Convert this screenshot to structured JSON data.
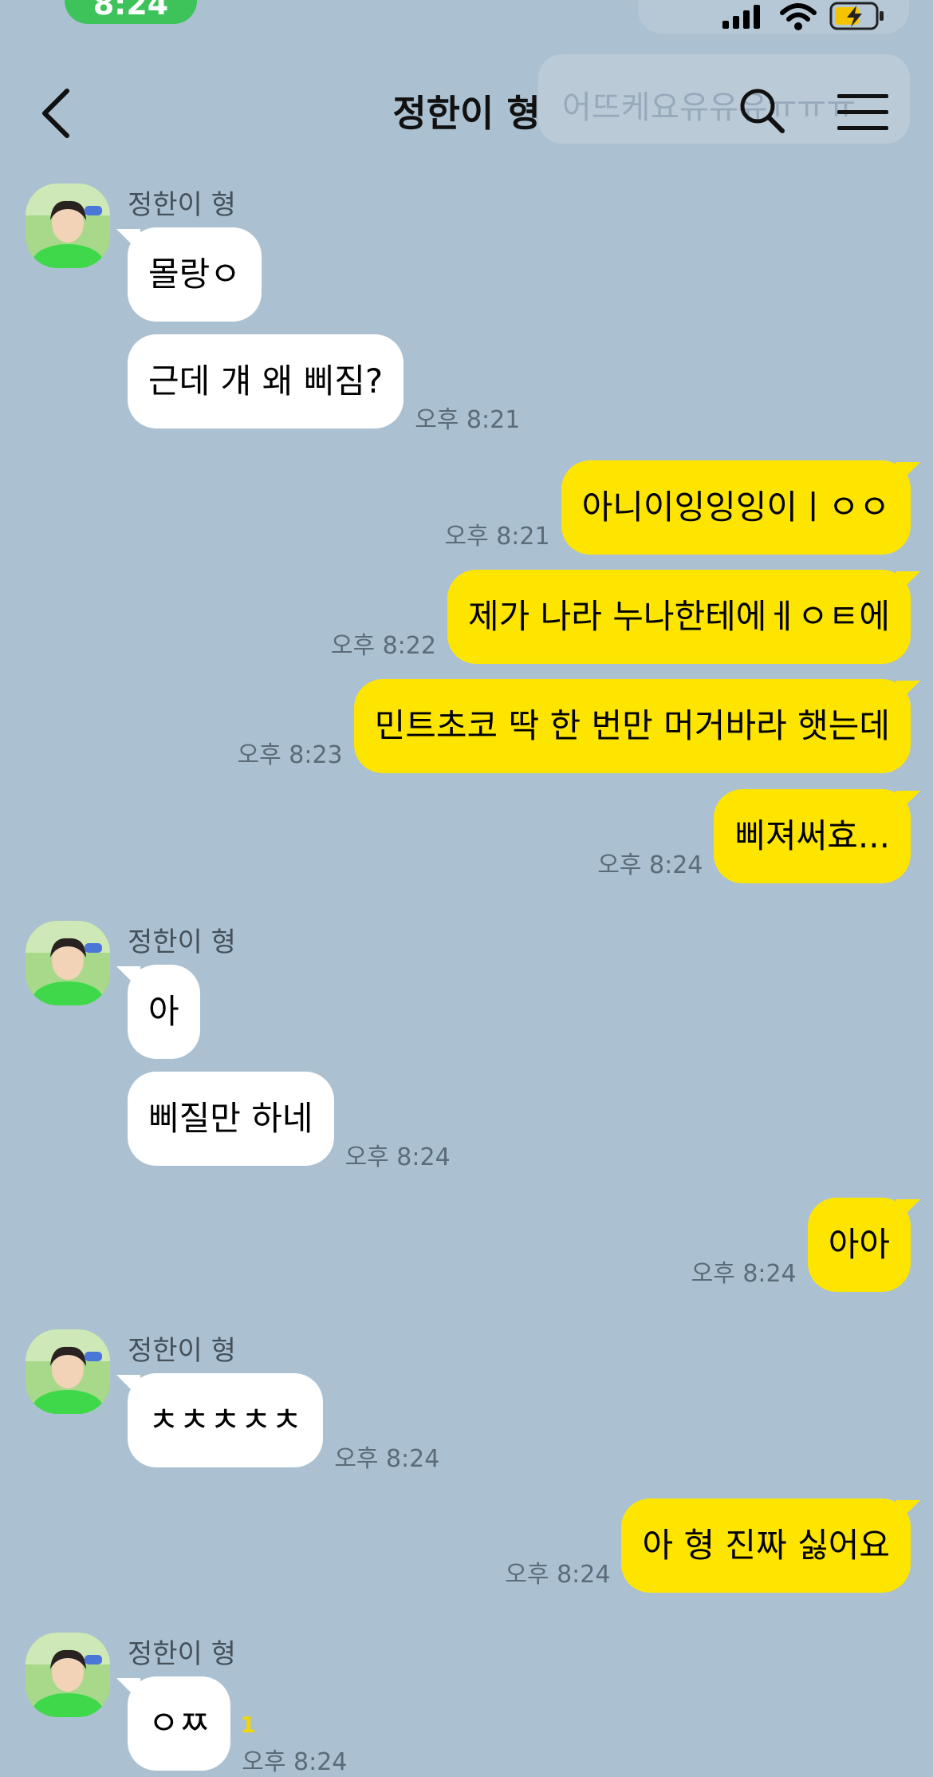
{
  "status": {
    "time": "8:24"
  },
  "header": {
    "title": "정한이 형",
    "ghost_preview": "어뜨케요유유유ㅠㅠㅠ"
  },
  "messages": [
    {
      "type": "in",
      "name": "정한이 형",
      "text": "몰랑ㅇ",
      "time": ""
    },
    {
      "type": "in",
      "text": "근데 걔 왜 삐짐?",
      "time": "오후 8:21"
    },
    {
      "type": "out",
      "text": "아니이잉잉잉이ㅣㅇㅇ",
      "time": "오후 8:21"
    },
    {
      "type": "out",
      "text": "제가 나라 누나한테에ㅔㅇㅌ에",
      "time": "오후 8:22"
    },
    {
      "type": "out",
      "text": "민트초코 딱 한 번만 머거바라 햇는데",
      "time": "오후 8:23"
    },
    {
      "type": "out",
      "text": "삐져써효...",
      "time": "오후 8:24"
    },
    {
      "type": "in",
      "name": "정한이 형",
      "text": "아",
      "time": ""
    },
    {
      "type": "in",
      "text": "삐질만 하네",
      "time": "오후 8:24"
    },
    {
      "type": "out",
      "text": "아아",
      "time": "오후 8:24"
    },
    {
      "type": "in",
      "name": "정한이 형",
      "text": "ㅊㅊㅊㅊㅊ",
      "time": "오후 8:24"
    },
    {
      "type": "out",
      "text": "아 형 진짜 싫어요",
      "time": "오후 8:24"
    },
    {
      "type": "in",
      "name": "정한이 형",
      "text": "ㅇㅉ",
      "time": "오후 8:24",
      "unread": "1"
    }
  ],
  "colors": {
    "background": "#abc1d1",
    "outgoing": "#fee500",
    "incoming": "#ffffff"
  },
  "icons": [
    "back-icon",
    "search-icon",
    "menu-icon",
    "signal-icon",
    "wifi-icon",
    "battery-icon"
  ]
}
